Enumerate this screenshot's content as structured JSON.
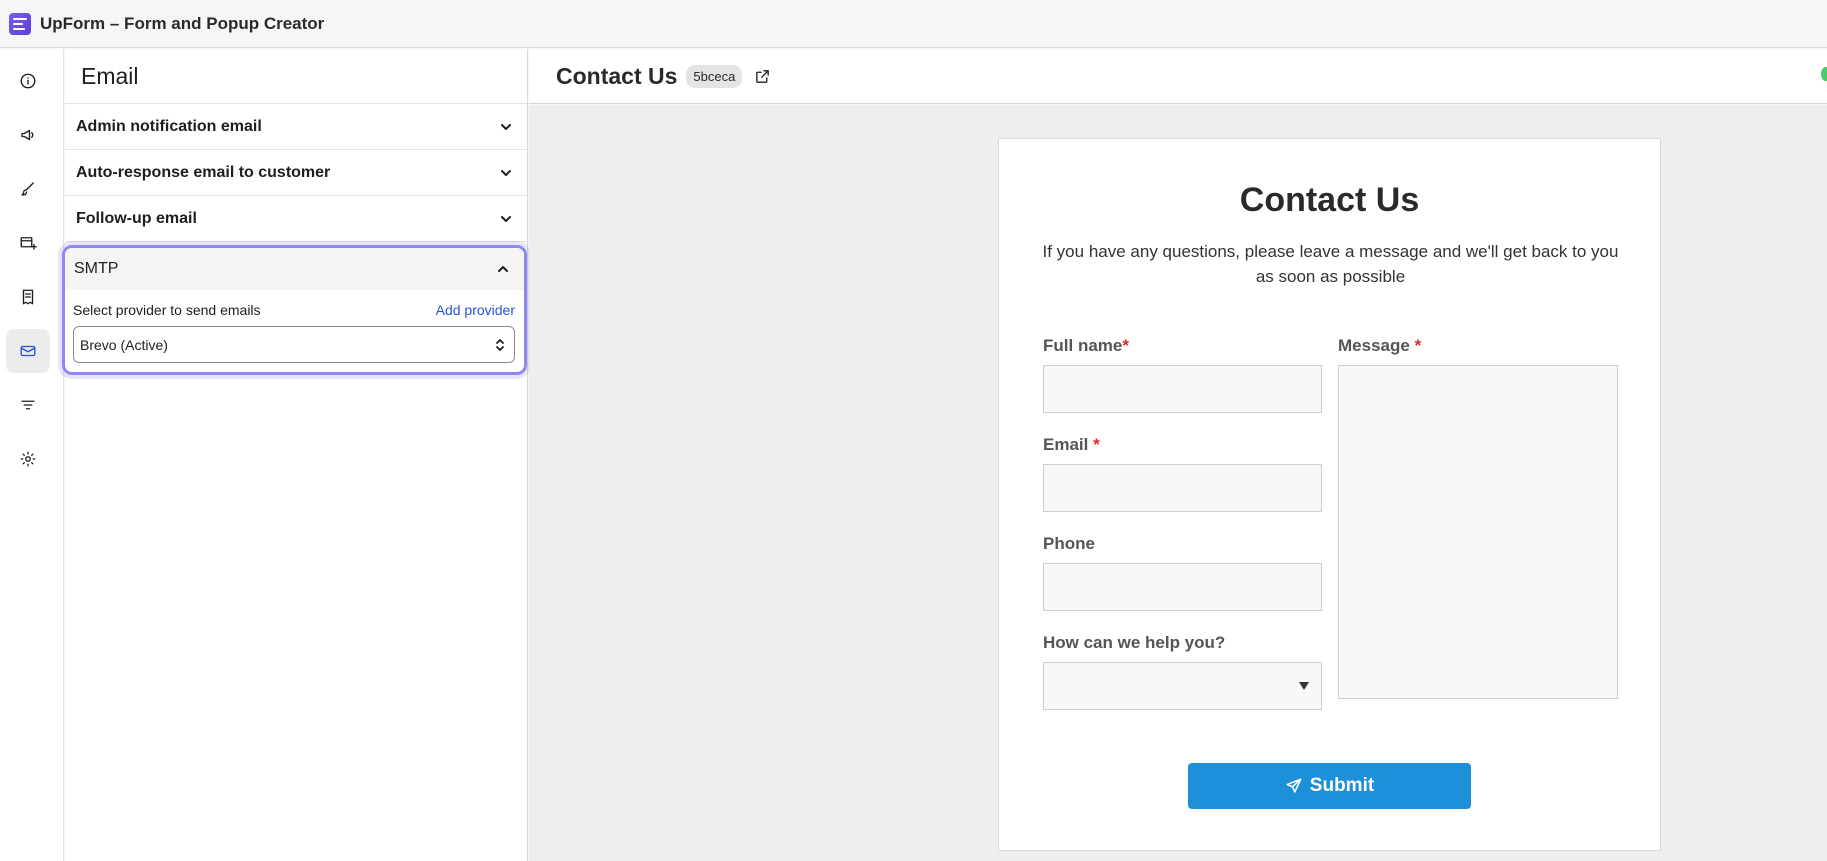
{
  "app": {
    "title": "UpForm – Form and Popup Creator",
    "logo_icon": "upform-logo-icon"
  },
  "rail": {
    "items": [
      {
        "icon": "info-icon"
      },
      {
        "icon": "megaphone-icon"
      },
      {
        "icon": "paintbrush-icon"
      },
      {
        "icon": "add-field-icon"
      },
      {
        "icon": "receipt-icon"
      },
      {
        "icon": "email-icon",
        "active": true
      },
      {
        "icon": "filter-icon"
      },
      {
        "icon": "gear-icon"
      }
    ],
    "accent": "#2454d6"
  },
  "panel": {
    "title": "Email",
    "items": [
      {
        "label": "Admin notification email"
      },
      {
        "label": "Auto-response email to customer"
      },
      {
        "label": "Follow-up email"
      }
    ],
    "smtp": {
      "label": "SMTP",
      "provider_label": "Select provider to send emails",
      "add_provider": "Add provider",
      "selected_provider": "Brevo (Active)",
      "highlight_color": "#8f88f2"
    }
  },
  "main": {
    "form_title": "Contact Us",
    "form_id": "5bceca",
    "status_color": "#4cc96b"
  },
  "form": {
    "heading": "Contact Us",
    "description": "If you have any questions, please leave a message and we'll get back to you as soon as possible",
    "fields": {
      "full_name": "Full name",
      "email": "Email",
      "phone": "Phone",
      "help": "How can we help you?",
      "message": "Message"
    },
    "required_mark": "*",
    "submit": "Submit",
    "submit_color": "#1e8fd9"
  }
}
